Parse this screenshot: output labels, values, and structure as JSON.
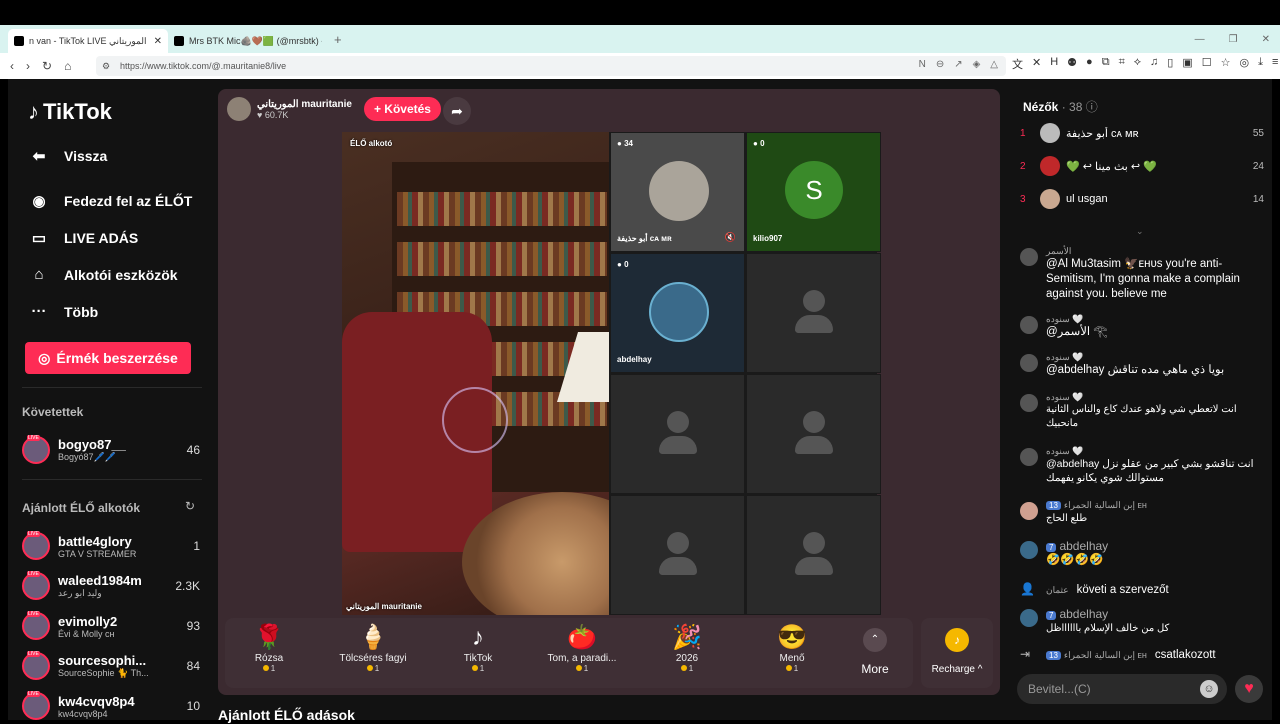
{
  "browser": {
    "tabs": [
      {
        "title": "n van - TikTok LIVE الموريتاني",
        "active": true
      },
      {
        "title": "Mrs BTK Mic🪨🤎🟩 (@mrsbtk) - T",
        "active": false
      }
    ],
    "url": "https://www.tiktok.com/@.mauritanie8/live"
  },
  "sidebar": {
    "logo": "TikTok",
    "back": "Vissza",
    "nav": [
      {
        "label": "Fedezd fel az ÉLŐT",
        "icon": "avatar-icon"
      },
      {
        "label": "LIVE ADÁS",
        "icon": "video-camera-icon"
      },
      {
        "label": "Alkotói eszközök",
        "icon": "creator-tools-icon"
      },
      {
        "label": "Több",
        "icon": "more-dots-icon"
      }
    ],
    "coins_button": "Érmék beszerzése",
    "following_title": "Követettek",
    "following": [
      {
        "name": "bogyo87__",
        "sub": "Bogyó87🖊️🖊️",
        "count": "46"
      }
    ],
    "recommended_title": "Ajánlott ÉLŐ alkotók",
    "recommended": [
      {
        "name": "battle4glory",
        "sub": "GTA V STREAMER",
        "count": "1"
      },
      {
        "name": "waleed1984m",
        "sub": "وليد ابو رعد",
        "count": "2.3K"
      },
      {
        "name": "evimolly2",
        "sub": "Évi & Molly ᴄʜ",
        "count": "93"
      },
      {
        "name": "sourcesophi...",
        "sub": "SourceSophie 🐈 Th...",
        "count": "84"
      },
      {
        "name": "kw4cvqv8p4",
        "sub": "kw4cvqv8p4",
        "count": "10"
      }
    ]
  },
  "stream": {
    "host_name": "الموريتاني mauritanie",
    "host_likes": "60.7K",
    "follow_button": "+ Követés",
    "main_label": "ÉLŐ alkotó",
    "main_bottom_label": "الموريتاني mauritanie",
    "guests": [
      {
        "badge": "34",
        "name": "أبو حذيفة ᴄᴀ ᴍʀ"
      },
      {
        "badge": "0",
        "name": "kilio907",
        "initial": "S"
      },
      {
        "badge": "0",
        "name": "abdelhay"
      },
      {
        "badge": "",
        "name": ""
      },
      {
        "badge": "",
        "name": ""
      },
      {
        "badge": "",
        "name": ""
      },
      {
        "badge": "",
        "name": ""
      },
      {
        "badge": "",
        "name": ""
      }
    ],
    "gifts": [
      {
        "name": "Rózsa",
        "price": "1",
        "icon": "🌹"
      },
      {
        "name": "Tölcséres fagyi",
        "price": "1",
        "icon": "🍦"
      },
      {
        "name": "TikTok",
        "price": "1",
        "icon": "♪"
      },
      {
        "name": "Tom, a paradi...",
        "price": "1",
        "icon": "🍅"
      },
      {
        "name": "2026",
        "price": "1",
        "icon": "🎉"
      },
      {
        "name": "Menő",
        "price": "1",
        "icon": "😎"
      }
    ],
    "more_label": "More",
    "recharge_label": "Recharge ^",
    "below_title": "Ajánlott ÉLŐ adások"
  },
  "chat": {
    "viewers_title": "Nézők",
    "viewers_count": "· 38",
    "top_viewers": [
      {
        "rank": "1",
        "name": "أبو حذيفة ᴄᴀ ᴍʀ",
        "score": "55"
      },
      {
        "rank": "2",
        "name": "💚 ↩ بث مينا ↩ 💚",
        "score": "24"
      },
      {
        "rank": "3",
        "name": "ul usgan",
        "score": "14"
      }
    ],
    "messages": [
      {
        "user": "الأسمر",
        "text": "@Al Mu3tasim 🦅ᴇʜᴜs you're anti-Semitism, I'm gonna make a complain against you. believe me"
      },
      {
        "user": "سنوده 🤍",
        "text": "@الأسمر 𓂀"
      },
      {
        "user": "سنوده 🤍",
        "text": "@abdelhay بويا ذي ماهي مده تناقش"
      },
      {
        "user": "سنوده 🤍",
        "text": "انت لاتعطي شي ولاهو عندك كاع والناس الثانية مانحبيك"
      },
      {
        "user": "سنوده 🤍",
        "text": "@abdelhay انت تناقشو بشي كبير من عقلو نزل مستوالك شوي يكانو يفهمك"
      },
      {
        "user": "إبن السالية الحمراء ᴇʜ",
        "level": "13",
        "text": "طلع الحاج"
      },
      {
        "user": "abdelhay",
        "level": "7",
        "text": "🤣🤣🤣🤣"
      },
      {
        "user": "عثمان",
        "text": "követi a szervezőt"
      },
      {
        "user": "abdelhay",
        "level": "7",
        "text": "كل من خالف الإسلام بااااااظل"
      },
      {
        "user": "إبن السالية الحمراء ᴇʜ",
        "level": "13",
        "text": "csatlakozott"
      }
    ],
    "input_placeholder": "Bevitel...(C)"
  },
  "colors": {
    "accent": "#fe2c55",
    "stage": "#3b2a30",
    "background": "#121212",
    "coin": "#f5b800"
  }
}
